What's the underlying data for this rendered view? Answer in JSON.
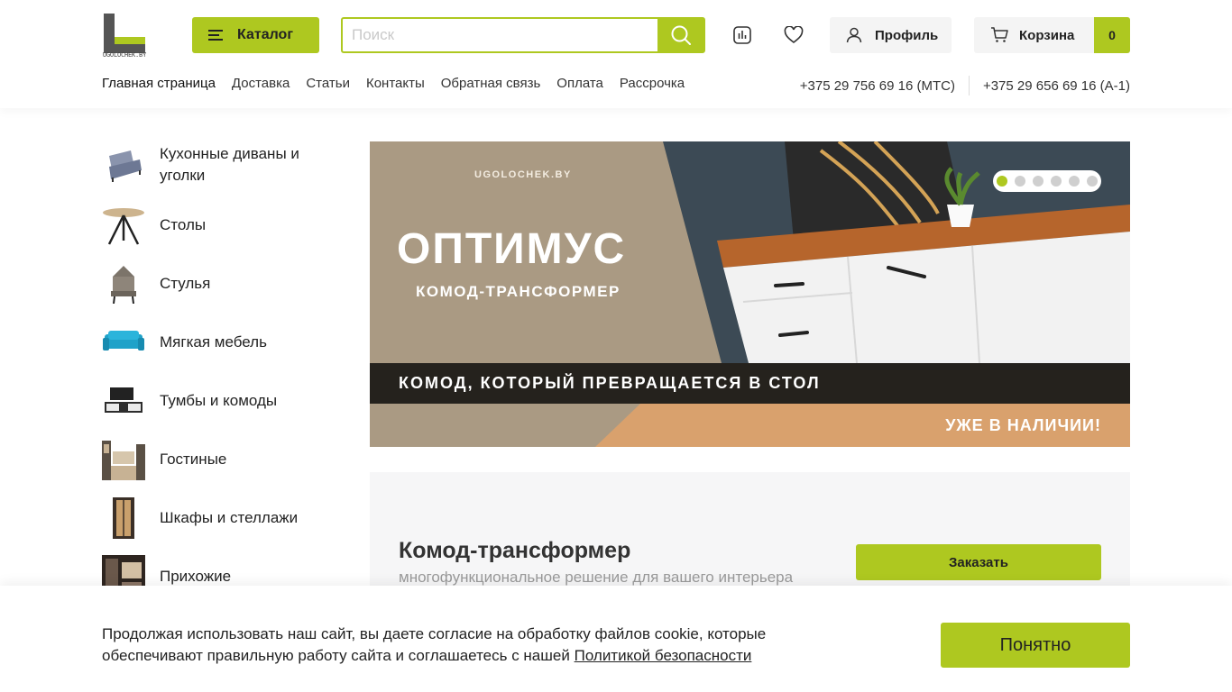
{
  "header": {
    "logo_text": "UGOLOCHEK.BY",
    "catalog_label": "Каталог",
    "search_placeholder": "Поиск",
    "profile_label": "Профиль",
    "cart_label": "Корзина",
    "cart_count": "0"
  },
  "nav": [
    {
      "label": "Главная страница"
    },
    {
      "label": "Доставка"
    },
    {
      "label": "Статьи"
    },
    {
      "label": "Контакты"
    },
    {
      "label": "Обратная связь"
    },
    {
      "label": "Оплата"
    },
    {
      "label": "Рассрочка"
    }
  ],
  "phones": [
    "+375 29 756 69 16 (МТС)",
    "+375 29 656 69 16 (А-1)"
  ],
  "categories": [
    {
      "name": "Кухонные диваны и уголки",
      "icon": "kitchen-sofa-icon"
    },
    {
      "name": "Столы",
      "icon": "table-icon"
    },
    {
      "name": "Стулья",
      "icon": "chair-icon"
    },
    {
      "name": "Мягкая мебель",
      "icon": "sofa-icon"
    },
    {
      "name": "Тумбы и комоды",
      "icon": "tv-stand-icon"
    },
    {
      "name": "Гостиные",
      "icon": "living-room-icon"
    },
    {
      "name": "Шкафы и стеллажи",
      "icon": "wardrobe-icon"
    },
    {
      "name": "Прихожие",
      "icon": "hallway-icon"
    }
  ],
  "banner": {
    "brand": "UGOLOCHEK.BY",
    "headline": "ОПТИМУС",
    "subheadline": "КОМОД-ТРАНСФОРМЕР",
    "strip_text": "КОМОД, КОТОРЫЙ ПРЕВРАЩАЕТСЯ В СТОЛ",
    "bottom_text": "УЖЕ В НАЛИЧИИ!",
    "slides_total": 6,
    "active_slide": 1
  },
  "card": {
    "title": "Комод-трансформер",
    "description": "многофункциональное решение для вашего интерьера",
    "order_label": "Заказать"
  },
  "cookie": {
    "text": "Продолжая использовать наш сайт, вы даете согласие на обработку файлов cookie, которые обеспечивают правильную работу сайта и соглашаетесь с нашей",
    "link_text": "Политикой безопасности",
    "accept_label": "Понятно"
  },
  "colors": {
    "accent": "#aec820",
    "banner_bg": "#aa9a83",
    "strip": "#25221d"
  }
}
